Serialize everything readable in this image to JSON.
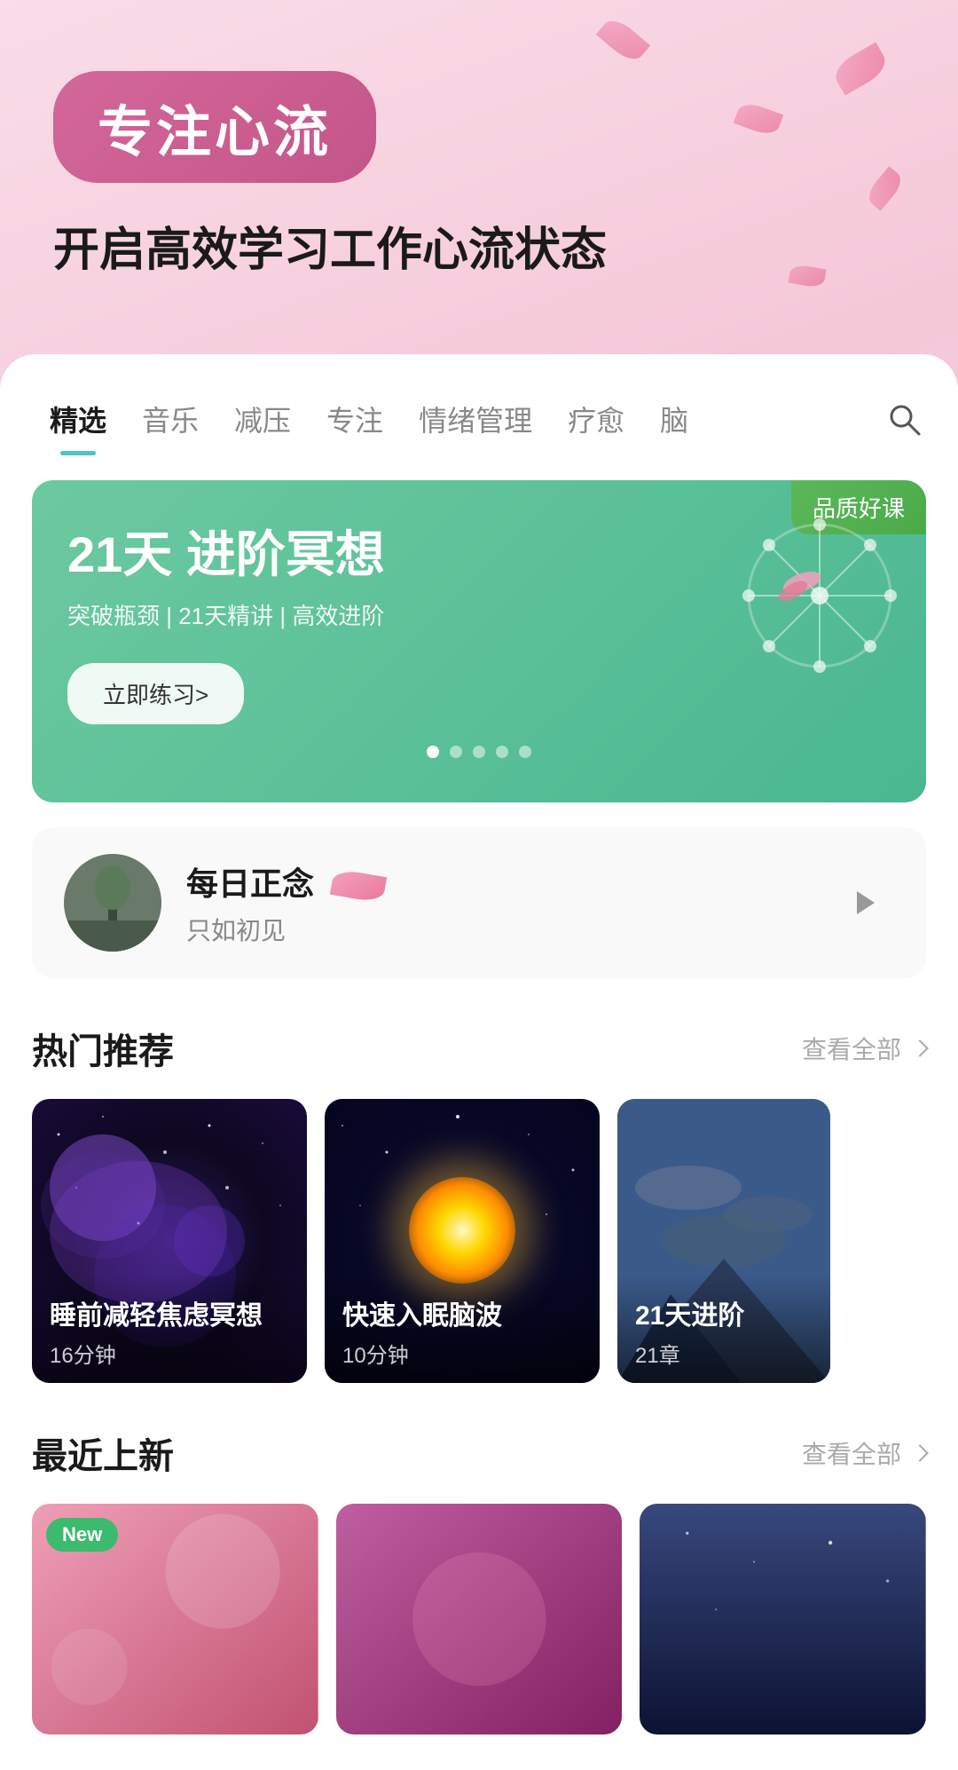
{
  "hero": {
    "badge_text": "专注心流",
    "subtitle": "开启高效学习工作心流状态"
  },
  "tabs": {
    "items": [
      {
        "label": "精选",
        "active": true
      },
      {
        "label": "音乐",
        "active": false
      },
      {
        "label": "减压",
        "active": false
      },
      {
        "label": "专注",
        "active": false
      },
      {
        "label": "情绪管理",
        "active": false
      },
      {
        "label": "疗愈",
        "active": false
      },
      {
        "label": "脑",
        "active": false
      }
    ]
  },
  "banner": {
    "quality_tag": "品质好课",
    "title": "21天 进阶冥想",
    "description": "突破瓶颈 | 21天精讲 | 高效进阶",
    "button_label": "立即练习>",
    "dots_count": 5
  },
  "daily": {
    "title": "每日正念",
    "subtitle": "只如初见"
  },
  "hot_section": {
    "title": "热门推荐",
    "more_label": "查看全部",
    "cards": [
      {
        "title": "睡前减轻焦虑冥想",
        "meta": "16分钟"
      },
      {
        "title": "快速入眠脑波",
        "meta": "10分钟"
      },
      {
        "title": "21天进阶",
        "meta": "21章"
      }
    ]
  },
  "new_section": {
    "title": "最近上新",
    "more_label": "查看全部",
    "new_badge": "New",
    "cards": [
      {
        "title": "",
        "meta": ""
      },
      {
        "title": "",
        "meta": ""
      },
      {
        "title": "",
        "meta": ""
      }
    ]
  },
  "icons": {
    "search": "🔍",
    "play": "▷",
    "chevron": "›"
  }
}
